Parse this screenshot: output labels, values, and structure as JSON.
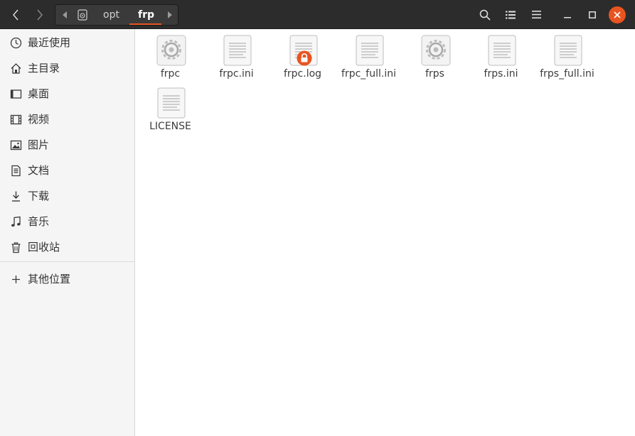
{
  "header": {
    "path_segments": [
      "opt",
      "frp"
    ],
    "current_segment": "frp"
  },
  "sidebar": {
    "items": [
      {
        "label": "最近使用",
        "icon": "clock-icon"
      },
      {
        "label": "主目录",
        "icon": "home-icon"
      },
      {
        "label": "桌面",
        "icon": "desktop-icon"
      },
      {
        "label": "视频",
        "icon": "video-icon"
      },
      {
        "label": "图片",
        "icon": "picture-icon"
      },
      {
        "label": "文档",
        "icon": "document-icon"
      },
      {
        "label": "下载",
        "icon": "download-icon"
      },
      {
        "label": "音乐",
        "icon": "music-icon"
      },
      {
        "label": "回收站",
        "icon": "trash-icon"
      }
    ],
    "other_locations": {
      "label": "其他位置",
      "icon": "plus-icon"
    }
  },
  "files": [
    {
      "name": "frpc",
      "type": "executable"
    },
    {
      "name": "frpc.ini",
      "type": "text"
    },
    {
      "name": "frpc.log",
      "type": "text-locked"
    },
    {
      "name": "frpc_full.ini",
      "type": "text"
    },
    {
      "name": "frps",
      "type": "executable"
    },
    {
      "name": "frps.ini",
      "type": "text"
    },
    {
      "name": "frps_full.ini",
      "type": "text"
    },
    {
      "name": "LICENSE",
      "type": "text"
    }
  ],
  "colors": {
    "accent": "#e95420",
    "header_bg": "#2c2c2c",
    "sidebar_bg": "#f5f5f5"
  }
}
